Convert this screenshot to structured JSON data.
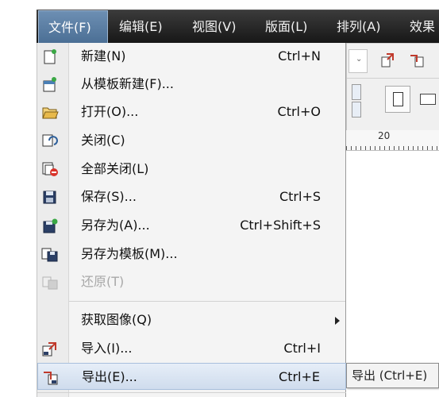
{
  "menubar": {
    "items": [
      {
        "label": "文件(F)"
      },
      {
        "label": "编辑(E)"
      },
      {
        "label": "视图(V)"
      },
      {
        "label": "版面(L)"
      },
      {
        "label": "排列(A)"
      },
      {
        "label": "效果"
      }
    ]
  },
  "file_menu": {
    "items": [
      {
        "label": "新建(N)",
        "shortcut": "Ctrl+N",
        "icon": "new-document-icon"
      },
      {
        "label": "从模板新建(F)...",
        "shortcut": "",
        "icon": "new-from-template-icon"
      },
      {
        "label": "打开(O)...",
        "shortcut": "Ctrl+O",
        "icon": "open-folder-icon"
      },
      {
        "label": "关闭(C)",
        "shortcut": "",
        "icon": "close-document-icon"
      },
      {
        "label": "全部关闭(L)",
        "shortcut": "",
        "icon": "close-all-icon"
      },
      {
        "label": "保存(S)...",
        "shortcut": "Ctrl+S",
        "icon": "save-icon"
      },
      {
        "label": "另存为(A)...",
        "shortcut": "Ctrl+Shift+S",
        "icon": "save-as-icon"
      },
      {
        "label": "另存为模板(M)...",
        "shortcut": "",
        "icon": "save-as-template-icon"
      },
      {
        "label": "还原(T)",
        "shortcut": "",
        "icon": "revert-icon",
        "disabled": true
      },
      {
        "label": "获取图像(Q)",
        "shortcut": "",
        "icon": "",
        "submenu": true
      },
      {
        "label": "导入(I)...",
        "shortcut": "Ctrl+I",
        "icon": "import-icon"
      },
      {
        "label": "导出(E)...",
        "shortcut": "Ctrl+E",
        "icon": "export-icon",
        "highlighted": true
      }
    ]
  },
  "ruler": {
    "label": "20"
  },
  "tooltip": {
    "text": "导出 (Ctrl+E)"
  }
}
